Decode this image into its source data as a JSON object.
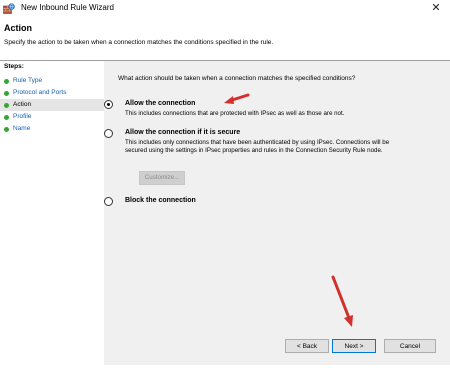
{
  "window": {
    "title": "New Inbound Rule Wizard",
    "close_glyph": "✕"
  },
  "header": {
    "title": "Action",
    "description": "Specify the action to be taken when a connection matches the conditions specified in the rule."
  },
  "steps": {
    "title": "Steps:",
    "items": [
      {
        "label": "Rule Type"
      },
      {
        "label": "Protocol and Ports"
      },
      {
        "label": "Action",
        "current": true
      },
      {
        "label": "Profile"
      },
      {
        "label": "Name"
      }
    ]
  },
  "main": {
    "prompt": "What action should be taken when a connection matches the specified conditions?",
    "options": [
      {
        "label": "Allow the connection",
        "description": "This includes connections that are protected with IPsec as well as those are not.",
        "selected": true
      },
      {
        "label": "Allow the connection if it is secure",
        "description": "This includes only connections that have been authenticated by using IPsec.  Connections will be secured using the settings in IPsec properties and rules in the Connection Security Rule node.",
        "selected": false
      },
      {
        "label": "Block the connection",
        "description": "",
        "selected": false
      }
    ],
    "customize_label": "Customize..."
  },
  "footer": {
    "back_label": "< Back",
    "next_label": "Next >",
    "cancel_label": "Cancel"
  },
  "colors": {
    "annotation_arrow": "#d0312d",
    "step_bullet": "#3aa335",
    "step_link": "#1a5fb4"
  },
  "icons": {
    "window_icon": "firewall-icon",
    "annotation": "red-arrow-icon"
  }
}
